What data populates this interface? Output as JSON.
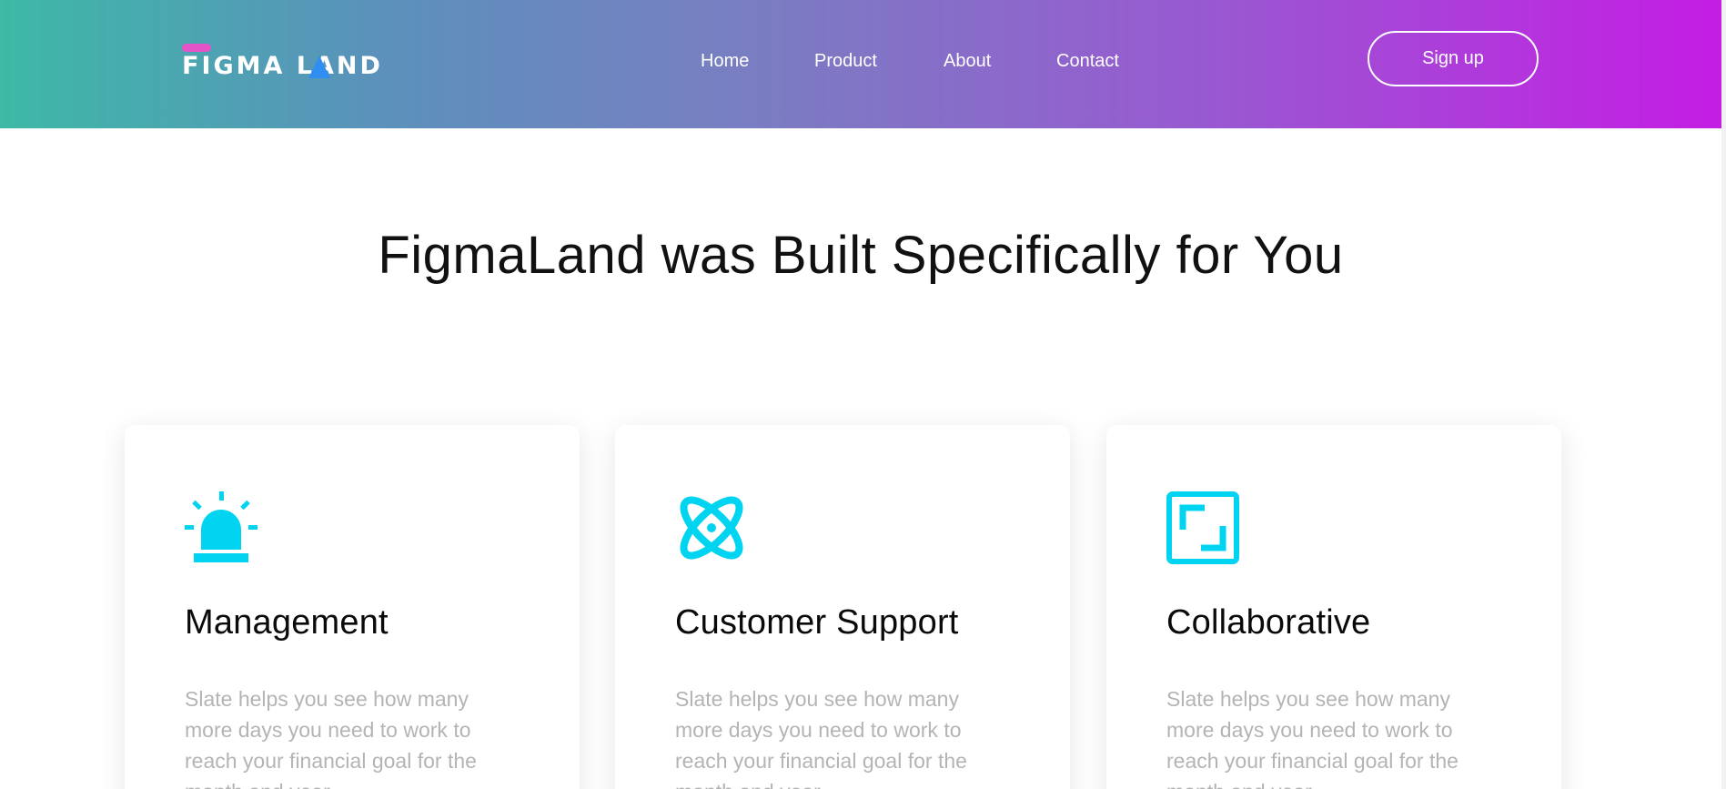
{
  "header": {
    "logo_text": "FIGMA LAND",
    "nav": {
      "home": "Home",
      "product": "Product",
      "about": "About",
      "contact": "Contact"
    },
    "signup_label": "Sign up"
  },
  "hero": {
    "title": "FigmaLand was Built Specifically for You"
  },
  "cards": [
    {
      "icon": "siren-icon",
      "title": "Management",
      "description": "Slate helps you see how many more days you need to work to reach your financial goal for the month and year."
    },
    {
      "icon": "atom-icon",
      "title": "Customer Support",
      "description": "Slate helps you see how many more days you need to work to reach your financial goal for the month and year."
    },
    {
      "icon": "expand-frame-icon",
      "title": "Collaborative",
      "description": "Slate helps you see how many more days you need to work to reach your financial goal for the month and year."
    }
  ],
  "colors": {
    "header_gradient_start": "#3db9a6",
    "header_gradient_end": "#c41de4",
    "icon_accent": "#00d4f0",
    "logo_accent": "#e254c8",
    "text_muted": "#b4b4b4"
  }
}
